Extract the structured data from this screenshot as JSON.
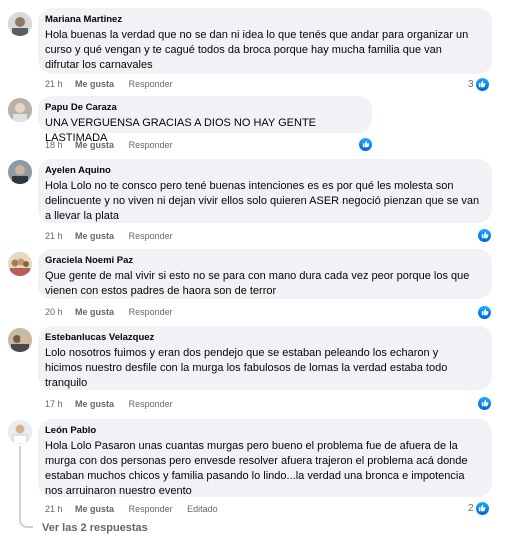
{
  "actions": {
    "like_label": "Me gusta",
    "reply_label": "Responder",
    "edited_label": "Editado"
  },
  "comments": [
    {
      "author": "Mariana Martinez",
      "lines": [
        "Hola buenas la verdad que no se dan ni idea lo que tenés que andar para organizar un",
        "curso y qué vengan y te cagué todos da broca porque hay mucha familia que van",
        "difrutar los carnavales"
      ],
      "time": "21 h",
      "reactions": "3"
    },
    {
      "author": "Papu De Caraza",
      "lines": [
        "UNA VERGUENSA GRACIAS A DIOS NO HAY GENTE LASTIMADA"
      ],
      "time": "18 h",
      "reactions": ""
    },
    {
      "author": "Ayelen Aquino",
      "lines": [
        "Hola Lolo no te consco pero tené buenas intenciones es es por qué les molesta son",
        "delincuente y no viven ni dejan vivir ellos solo quieren ASER negoció pienzan que se van",
        "a llevar la plata"
      ],
      "time": "21 h",
      "reactions": ""
    },
    {
      "author": "Graciela Noemi Paz",
      "lines": [
        "Que gente de mal vivir si esto no se para con mano dura cada vez peor porque los que",
        "vienen con estos padres de haora son de terror"
      ],
      "time": "20 h",
      "reactions": ""
    },
    {
      "author": "Estebanlucas Velazquez",
      "lines": [
        "Lolo nosotros fuimos y eran dos pendejo que se estaban peleando los echaron y",
        "hicimos nuestro desfile con la murga los fabulosos de lomas la verdad estaba todo",
        "tranquilo"
      ],
      "time": "17 h",
      "reactions": ""
    },
    {
      "author": "León Pablo",
      "lines": [
        "Hola Lolo Pasaron unas cuantas murgas pero bueno el problema fue de afuera de la",
        "murga con dos personas pero envesde resolver afuera trajeron el problema acá donde",
        "estaban muchos chicos y familia pasando lo lindo...la verdad una bronca e impotencia",
        "nos arruinaron nuestro evento"
      ],
      "time": "21 h",
      "reactions": "2",
      "edited": true
    }
  ],
  "view_replies": "Ver las 2 respuestas",
  "colors": {
    "bubble": "#f0f2f5",
    "meta": "#65676b",
    "like_blue": "#0866ff"
  }
}
